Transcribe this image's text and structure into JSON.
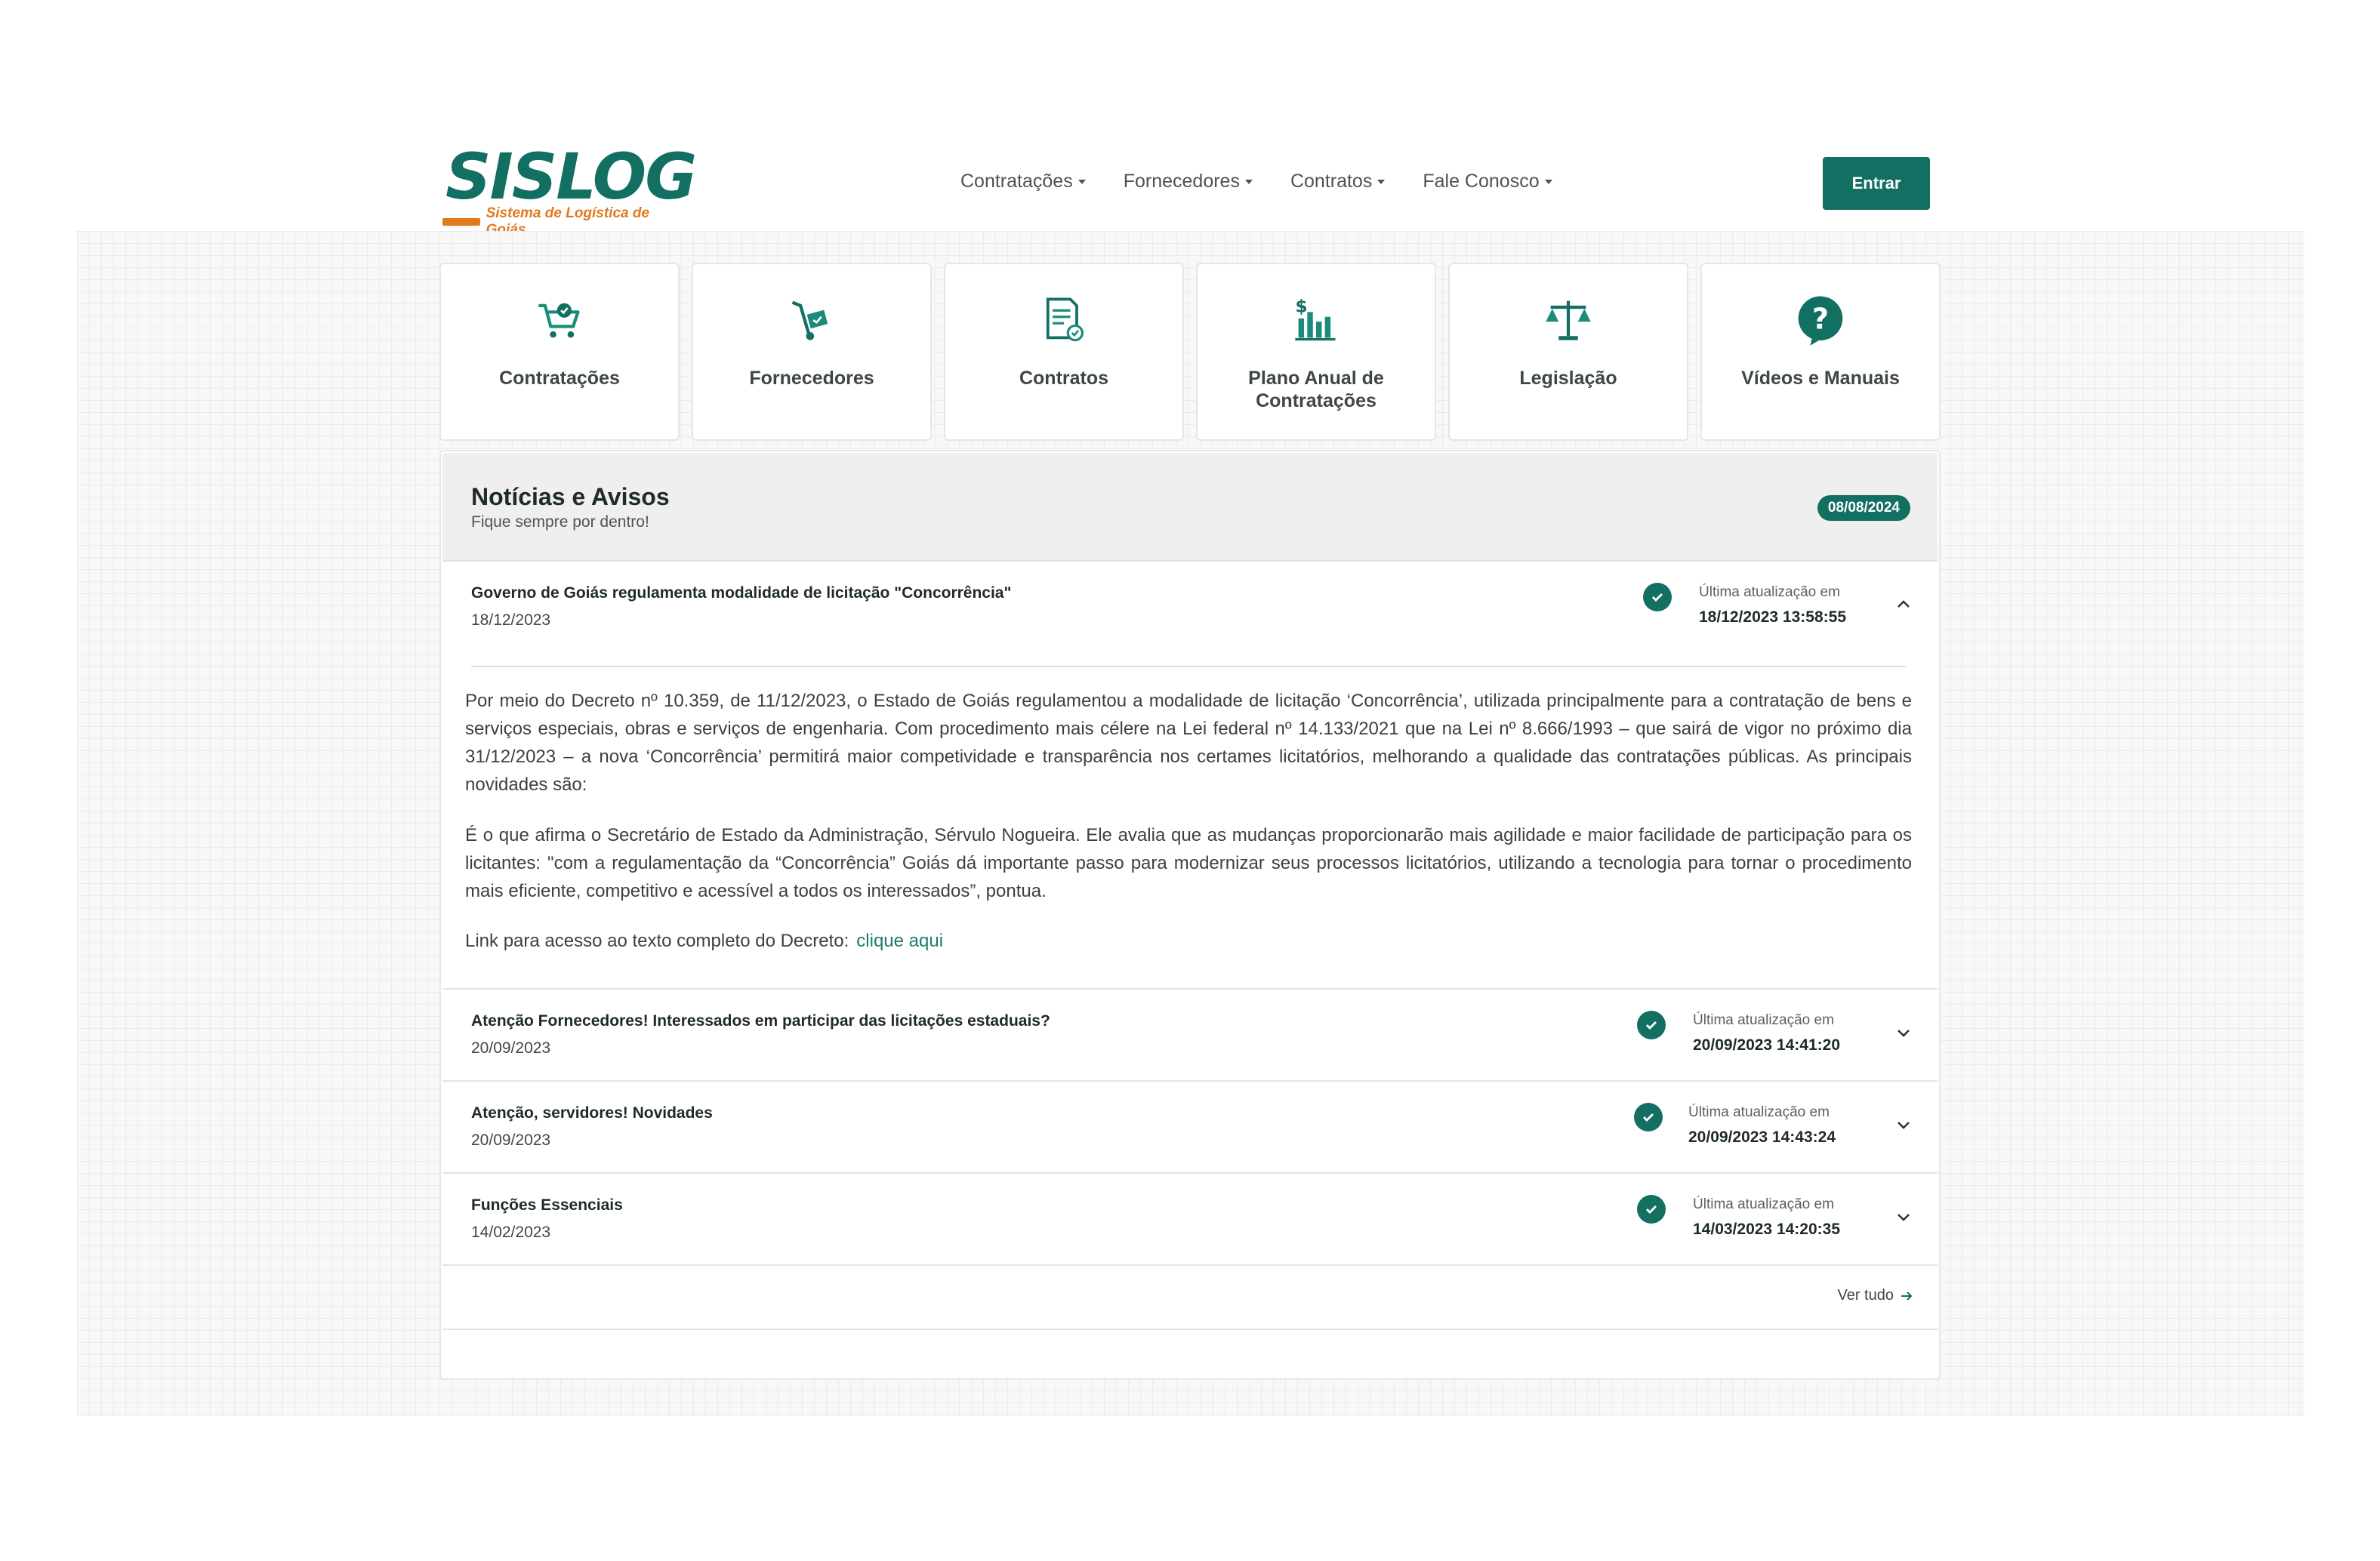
{
  "logo": {
    "word": "SISLOG",
    "tagline": "Sistema de Logística de Goiás"
  },
  "nav": [
    {
      "label": "Contratações"
    },
    {
      "label": "Fornecedores"
    },
    {
      "label": "Contratos"
    },
    {
      "label": "Fale Conosco"
    }
  ],
  "header": {
    "login_label": "Entrar"
  },
  "tiles": [
    {
      "label": "Contratações",
      "icon": "cart-check-icon"
    },
    {
      "label": "Fornecedores",
      "icon": "hand-truck-icon"
    },
    {
      "label": "Contratos",
      "icon": "document-check-icon"
    },
    {
      "label": "Plano Anual de Contratações",
      "icon": "dollar-chart-icon"
    },
    {
      "label": "Legislação",
      "icon": "scales-icon"
    },
    {
      "label": "Vídeos e Manuais",
      "icon": "question-bubble-icon"
    }
  ],
  "news": {
    "title": "Notícias e Avisos",
    "subtitle": "Fique sempre por dentro!",
    "date_badge": "08/08/2024",
    "update_label": "Última atualização em",
    "items": [
      {
        "title": "Governo de Goiás regulamenta modalidade de licitação \"Concorrência\"",
        "date": "18/12/2023",
        "updated": "18/12/2023 13:58:55",
        "expanded": true,
        "body": [
          "Por meio do Decreto nº 10.359, de 11/12/2023, o Estado de Goiás regulamentou a modalidade de licitação ‘Concorrência’, utilizada principalmente para a contratação de bens e serviços especiais, obras e serviços de engenharia. Com procedimento mais célere na Lei federal nº 14.133/2021 que na Lei nº 8.666/1993 – que sairá de vigor no próximo dia 31/12/2023 – a nova ‘Concorrência’ permitirá maior competividade e transparência nos certames licitatórios, melhorando a qualidade das contratações públicas. As principais novidades são:",
          "É o que afirma o Secretário de Estado da Administração, Sérvulo Nogueira. Ele avalia que as mudanças proporcionarão mais agilidade e maior facilidade de participação para os licitantes: \"com a regulamentação da “Concorrência” Goiás dá importante passo para modernizar seus processos licitatórios, utilizando a tecnologia para tornar o procedimento mais eficiente, competitivo e acessível a todos os interessados”, pontua."
        ],
        "link_prefix": "Link para acesso ao texto completo do Decreto:",
        "link_label": "clique aqui"
      },
      {
        "title": "Atenção Fornecedores! Interessados em participar das licitações estaduais?",
        "date": "20/09/2023",
        "updated": "20/09/2023 14:41:20",
        "expanded": false
      },
      {
        "title": "Atenção, servidores! Novidades",
        "date": "20/09/2023",
        "updated": "20/09/2023 14:43:24",
        "expanded": false
      },
      {
        "title": "Funções Essenciais",
        "date": "14/02/2023",
        "updated": "14/03/2023 14:20:35",
        "expanded": false
      }
    ],
    "see_all_label": "Ver tudo"
  },
  "colors": {
    "primary": "#126f62",
    "accent_orange": "#e07a1d"
  }
}
